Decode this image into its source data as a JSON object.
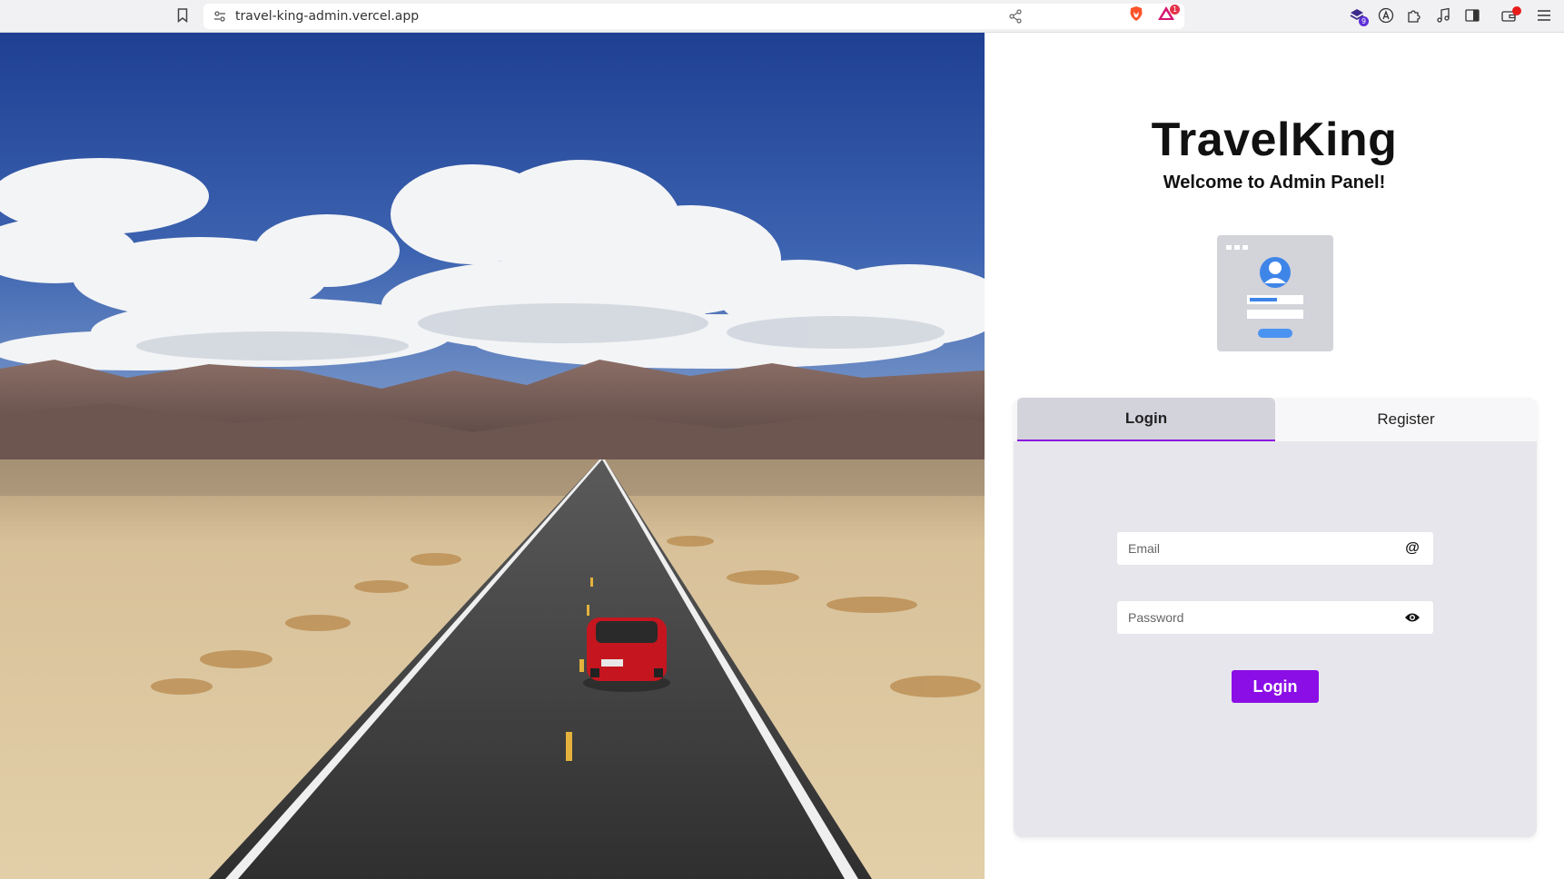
{
  "browser": {
    "url": "travel-king-admin.vercel.app",
    "rewards_badge": "1",
    "extension_badge": "9"
  },
  "panel": {
    "brand": "TravelKing",
    "welcome": "Welcome to Admin Panel!"
  },
  "tabs": [
    {
      "label": "Login",
      "active": true
    },
    {
      "label": "Register",
      "active": false
    }
  ],
  "form": {
    "email_placeholder": "Email",
    "email_value": "",
    "password_placeholder": "Password",
    "password_value": "",
    "submit_label": "Login"
  },
  "icons": {
    "email": "at-icon",
    "password": "eye-icon"
  },
  "colors": {
    "accent": "#8b0ee6",
    "card_bg": "#e6e6ec",
    "active_tab_bg": "#d3d3dc"
  }
}
